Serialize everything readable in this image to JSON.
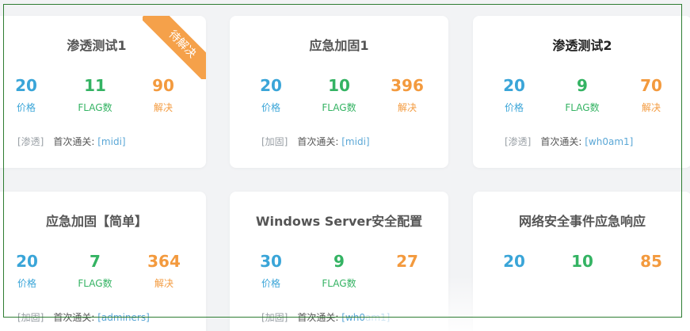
{
  "cards": [
    {
      "title": "渗透测试1",
      "ribbon": "待解决",
      "stats": [
        {
          "value": "20",
          "label": "价格"
        },
        {
          "value": "11",
          "label": "FLAG数"
        },
        {
          "value": "90",
          "label": "解决"
        }
      ],
      "tag": "[渗透]",
      "first_label": "首次通关:",
      "first_user": "[midi]"
    },
    {
      "title": "应急加固1",
      "stats": [
        {
          "value": "20",
          "label": "价格"
        },
        {
          "value": "10",
          "label": "FLAG数"
        },
        {
          "value": "396",
          "label": "解决"
        }
      ],
      "tag": "[加固]",
      "first_label": "首次通关:",
      "first_user": "[midi]"
    },
    {
      "title": "渗透测试2",
      "stats": [
        {
          "value": "20",
          "label": "价格"
        },
        {
          "value": "9",
          "label": "FLAG数"
        },
        {
          "value": "70",
          "label": "解决"
        }
      ],
      "tag": "[渗透]",
      "first_label": "首次通关:",
      "first_user": "[wh0am1]"
    },
    {
      "title": "应急加固【简单】",
      "stats": [
        {
          "value": "20",
          "label": "价格"
        },
        {
          "value": "7",
          "label": "FLAG数"
        },
        {
          "value": "364",
          "label": "解决"
        }
      ],
      "tag": "[加固]",
      "first_label": "首次通关:",
      "first_user": "[adminers]"
    },
    {
      "title": "Windows Server安全配置",
      "stats": [
        {
          "value": "30",
          "label": "价格"
        },
        {
          "value": "9",
          "label": "FLAG数"
        },
        {
          "value": "27",
          "label": ""
        }
      ],
      "tag": "[加固]",
      "first_label": "首次通关:",
      "first_user": "[wh0am1]"
    },
    {
      "title": "网络安全事件应急响应",
      "stats": [
        {
          "value": "20",
          "label": ""
        },
        {
          "value": "10",
          "label": ""
        },
        {
          "value": "85",
          "label": ""
        }
      ]
    }
  ],
  "colors": {
    "price": "#3aa5d8",
    "flags": "#34b363",
    "solved": "#f39a3e",
    "ribbon": "#f5a14a"
  }
}
